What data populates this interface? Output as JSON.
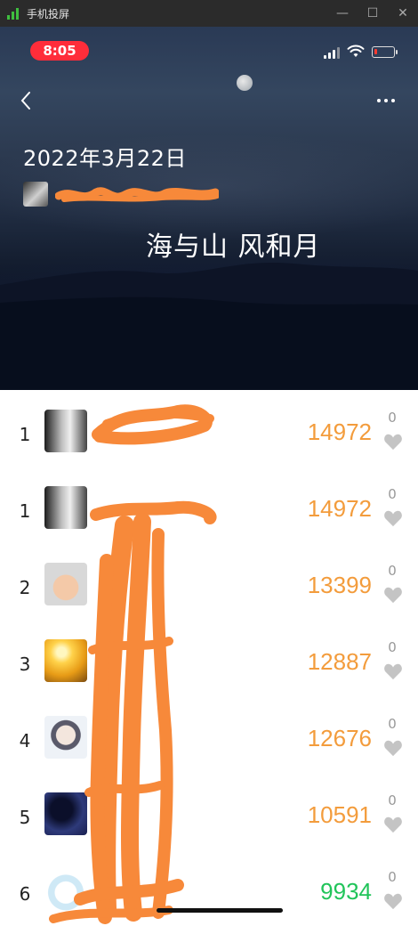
{
  "window": {
    "title": "手机投屏"
  },
  "status": {
    "time": "8:05"
  },
  "header": {
    "date": "2022年3月22日",
    "playlist_title": "海与山 风和月"
  },
  "colors": {
    "accent": "#f39c3c",
    "top_score": "#21c45a",
    "time_pill": "#ff2d3a"
  },
  "leaderboard": [
    {
      "rank": "1",
      "score": "14972",
      "likes": "0",
      "avatar": "bw-portrait"
    },
    {
      "rank": "1",
      "score": "14972",
      "likes": "0",
      "avatar": "bw-portrait"
    },
    {
      "rank": "2",
      "score": "13399",
      "likes": "0",
      "avatar": "baby-photo"
    },
    {
      "rank": "3",
      "score": "12887",
      "likes": "0",
      "avatar": "sunset-silhouette"
    },
    {
      "rank": "4",
      "score": "12676",
      "likes": "0",
      "avatar": "anime-boy"
    },
    {
      "rank": "5",
      "score": "10591",
      "likes": "0",
      "avatar": "night-silhouette"
    },
    {
      "rank": "6",
      "score": "9934",
      "likes": "0",
      "avatar": "cartoon-bear"
    }
  ]
}
